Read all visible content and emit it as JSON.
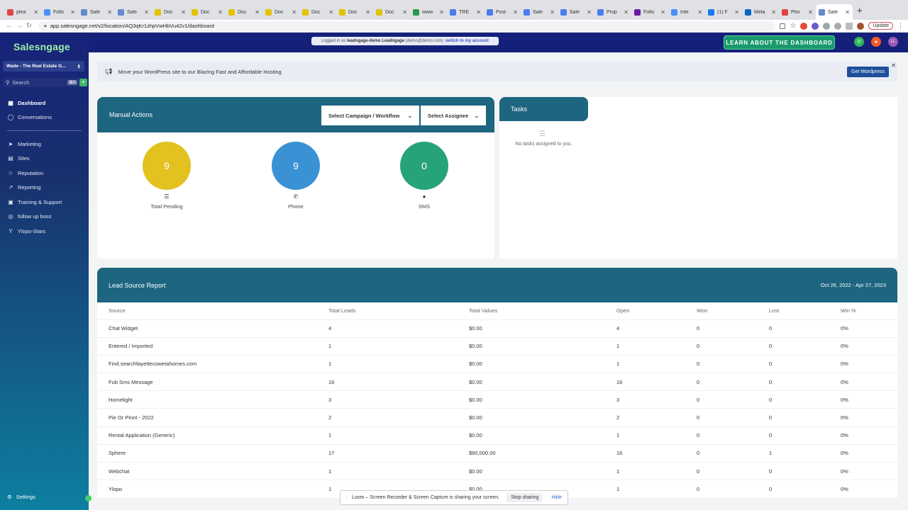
{
  "browser": {
    "tabs": [
      {
        "label": "plea",
        "color": "#d44"
      },
      {
        "label": "Follo",
        "color": "#4a8df6"
      },
      {
        "label": "Sale",
        "color": "#68c"
      },
      {
        "label": "Sale",
        "color": "#68c"
      },
      {
        "label": "Doc",
        "color": "#e3c200"
      },
      {
        "label": "Doc",
        "color": "#e3c200"
      },
      {
        "label": "Doc",
        "color": "#e3c200"
      },
      {
        "label": "Doc",
        "color": "#e3c200"
      },
      {
        "label": "Doc",
        "color": "#e3c200"
      },
      {
        "label": "Doc",
        "color": "#e3c200"
      },
      {
        "label": "Doc",
        "color": "#e3c200"
      },
      {
        "label": "www",
        "color": "#2a9a4a"
      },
      {
        "label": "TRE",
        "color": "#4a7df0"
      },
      {
        "label": "Post",
        "color": "#4a7df0"
      },
      {
        "label": "Sale",
        "color": "#4a7df0"
      },
      {
        "label": "Sale",
        "color": "#4a7df0"
      },
      {
        "label": "Prop",
        "color": "#4a7df0"
      },
      {
        "label": "Follo",
        "color": "#6a1aa0"
      },
      {
        "label": "Inte",
        "color": "#4a8df6"
      },
      {
        "label": "(1) F",
        "color": "#1877f2"
      },
      {
        "label": "Meta",
        "color": "#0a66c2"
      },
      {
        "label": "Pho",
        "color": "#e04040"
      },
      {
        "label": "Sale",
        "color": "#68c"
      }
    ],
    "url": "app.salesngage.net/v2/location/AQ3qKr1zhpVwHbVu42v1/dashboard",
    "update_label": "Update"
  },
  "sidebar": {
    "logo": "Salesngage",
    "account": "Wade - The Real Estate G...",
    "search_placeholder": "Search",
    "search_shortcut": "⌘K",
    "items_top": [
      {
        "label": "Dashboard",
        "icon": "grid-icon",
        "glyph": "▦"
      },
      {
        "label": "Conversations",
        "icon": "chat-icon",
        "glyph": "◯"
      }
    ],
    "items_main": [
      {
        "label": "Marketing",
        "icon": "send-icon",
        "glyph": "➤"
      },
      {
        "label": "Sites",
        "icon": "globe-icon",
        "glyph": "▤"
      },
      {
        "label": "Reputation",
        "icon": "star-icon",
        "glyph": "☆"
      },
      {
        "label": "Reporting",
        "icon": "trend-icon",
        "glyph": "↗"
      },
      {
        "label": "Training & Support",
        "icon": "book-icon",
        "glyph": "▣"
      },
      {
        "label": "follow up boss",
        "icon": "fub-icon",
        "glyph": "◎"
      },
      {
        "label": "Ylopo-Stars",
        "icon": "y-icon",
        "glyph": "Y"
      }
    ],
    "settings": "Settings"
  },
  "topbar": {
    "logged_in_prefix": "Logged in as",
    "user": "leadngage-demo Leadngage",
    "email": "(demo@demo.com)",
    "switch": "switch to my account",
    "learn": "LEARN ABOUT THE DASHBOARD",
    "avatar": "LL"
  },
  "banner": {
    "text": "Move your WordPress site to our Blazing Fast and Affordable Hosting",
    "button": "Get Wordpress"
  },
  "manual_actions": {
    "title": "Manual Actions",
    "campaign_select": "Select Campaign / Workflow",
    "assignee_select": "Select Assignee",
    "stats": [
      {
        "value": "9",
        "label": "Total Pending",
        "color": "#e3c11f",
        "glyph": "☰"
      },
      {
        "value": "9",
        "label": "Phone",
        "color": "#3a92d4",
        "glyph": "✆"
      },
      {
        "value": "0",
        "label": "SMS",
        "color": "#27a37a",
        "glyph": "●"
      }
    ]
  },
  "tasks": {
    "title": "Tasks",
    "empty": "No tasks assigned to you."
  },
  "lead_source": {
    "title": "Lead Source Report",
    "date_range": "Oct 26, 2022 - Apr 27, 2023",
    "columns": [
      "Source",
      "Total Leads",
      "Total Values",
      "Open",
      "Won",
      "Lost",
      "Win %"
    ],
    "rows": [
      [
        "Chat Widget",
        "4",
        "$0.00",
        "4",
        "0",
        "0",
        "0%"
      ],
      [
        "Entered / Imported",
        "1",
        "$0.00",
        "1",
        "0",
        "0",
        "0%"
      ],
      [
        "Find.searchfayettecowetahomes.com",
        "1",
        "$0.00",
        "1",
        "0",
        "0",
        "0%"
      ],
      [
        "Fub Sms Message",
        "16",
        "$0.00",
        "16",
        "0",
        "0",
        "0%"
      ],
      [
        "Homelight",
        "3",
        "$0.00",
        "3",
        "0",
        "0",
        "0%"
      ],
      [
        "Pie Or Pinot - 2022",
        "2",
        "$0.00",
        "2",
        "0",
        "0",
        "0%"
      ],
      [
        "Rental Application (Generic)",
        "1",
        "$0.00",
        "1",
        "0",
        "0",
        "0%"
      ],
      [
        "Sphere",
        "17",
        "$80,000.00",
        "16",
        "0",
        "1",
        "0%"
      ],
      [
        "Webchat",
        "1",
        "$0.00",
        "1",
        "0",
        "0",
        "0%"
      ],
      [
        "Ylopo",
        "1",
        "$0.00",
        "1",
        "0",
        "0",
        "0%"
      ]
    ]
  },
  "loom": {
    "text": "Loom – Screen Recorder & Screen Capture is sharing your screen.",
    "stop": "Stop sharing",
    "hide": "Hide"
  }
}
